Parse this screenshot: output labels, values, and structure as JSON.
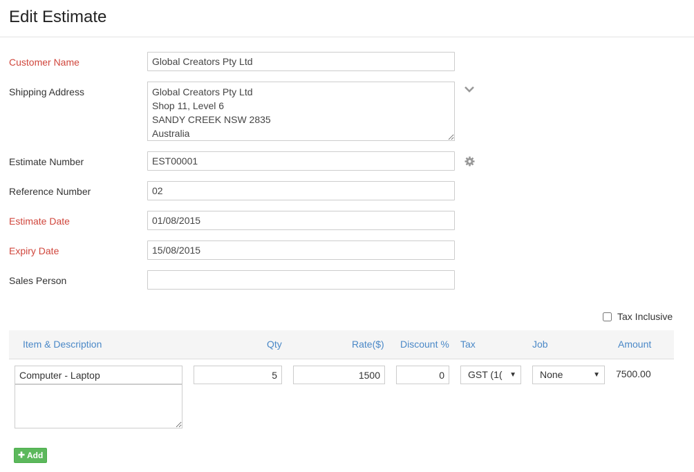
{
  "page": {
    "title": "Edit Estimate"
  },
  "form": {
    "customer_name": {
      "label": "Customer Name",
      "value": "Global Creators Pty Ltd"
    },
    "shipping_address": {
      "label": "Shipping Address",
      "value": "Global Creators Pty Ltd\nShop 11, Level 6\nSANDY CREEK NSW 2835\nAustralia"
    },
    "estimate_number": {
      "label": "Estimate Number",
      "value": "EST00001"
    },
    "reference_number": {
      "label": "Reference Number",
      "value": "02"
    },
    "estimate_date": {
      "label": "Estimate Date",
      "value": "01/08/2015"
    },
    "expiry_date": {
      "label": "Expiry Date",
      "value": "15/08/2015"
    },
    "sales_person": {
      "label": "Sales Person",
      "value": ""
    }
  },
  "icons": {
    "address_toggle": "chevron-down-icon",
    "estimate_settings": "gear-icon",
    "add": "plus-icon"
  },
  "tax_inclusive": {
    "label": "Tax Inclusive",
    "checked": false
  },
  "items_table": {
    "columns": {
      "item": "Item & Description",
      "qty": "Qty",
      "rate": "Rate($)",
      "discount": "Discount %",
      "tax": "Tax",
      "job": "Job",
      "amount": "Amount"
    },
    "rows": [
      {
        "item": "Computer - Laptop",
        "description": "",
        "qty": "5",
        "rate": "1500",
        "discount": "0",
        "tax": "GST (1(",
        "job": "None",
        "amount": "7500.00"
      }
    ]
  },
  "add_button": {
    "label": "Add"
  },
  "colors": {
    "required_label": "#d0463c",
    "column_header": "#4a88c7",
    "add_button": "#5cb85c"
  }
}
